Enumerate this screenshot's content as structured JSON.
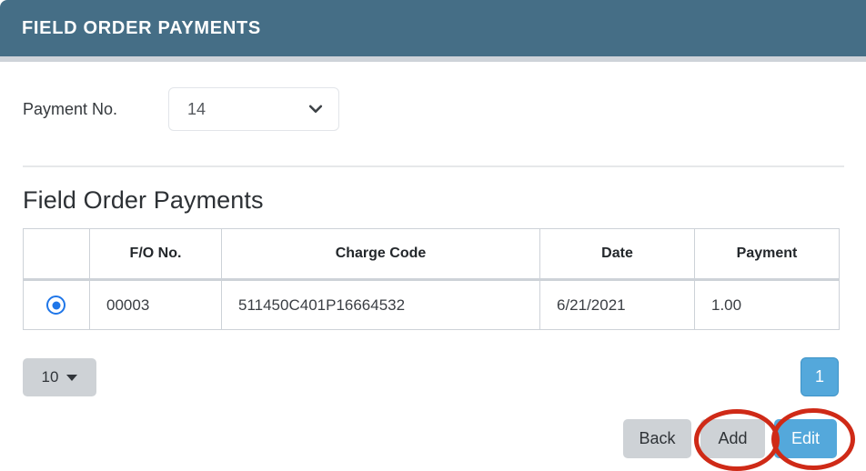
{
  "window": {
    "title": "FIELD ORDER PAYMENTS",
    "header_color": "#456e86"
  },
  "form": {
    "payment_no": {
      "label": "Payment No.",
      "value": "14",
      "icon": "chevron-down-icon"
    }
  },
  "section": {
    "heading": "Field Order Payments"
  },
  "table": {
    "columns": [
      "",
      "F/O No.",
      "Charge Code",
      "Date",
      "Payment"
    ],
    "rows": [
      {
        "selected": true,
        "fo_no": "00003",
        "charge_code": "511450C401P16664532",
        "date": "6/21/2021",
        "payment": "1.00"
      }
    ]
  },
  "pagination": {
    "page_size": "10",
    "page_size_icon": "caret-down-icon",
    "current_page": "1",
    "active_color": "#54a8db"
  },
  "actions": {
    "back_label": "Back",
    "add_label": "Add",
    "edit_label": "Edit",
    "primary_color": "#54a8db",
    "secondary_color": "#ced2d6"
  },
  "annotations": {
    "color": "#cf2a17",
    "highlighted": [
      "Add",
      "Edit"
    ]
  }
}
